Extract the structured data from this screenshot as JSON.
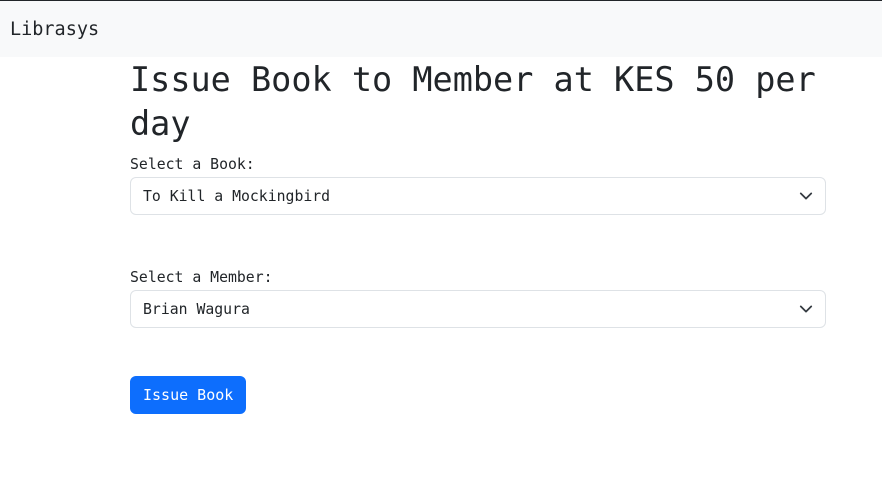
{
  "navbar": {
    "brand": "Librasys"
  },
  "page": {
    "title": "Issue Book to Member at KES 50 per day",
    "book_label": "Select a Book:",
    "book_selected": "To Kill a Mockingbird",
    "member_label": "Select a Member:",
    "member_selected": "Brian Wagura",
    "submit_label": "Issue Book"
  },
  "colors": {
    "primary": "#0d6efd",
    "navbar_bg": "#f8f9fa"
  }
}
